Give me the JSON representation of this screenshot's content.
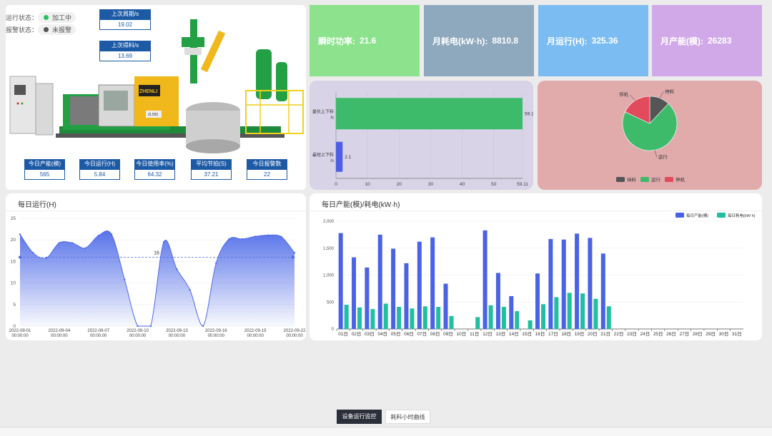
{
  "machine": {
    "run_status_label": "运行状态：",
    "run_status_value": "加工中",
    "run_status_color": "#22c55e",
    "alarm_status_label": "报警状态：",
    "alarm_status_value": "未报警",
    "alarm_status_color": "#555555",
    "last_cycle_label": "上次周期/s",
    "last_cycle_value": "19.02",
    "last_fetch_label": "上次得料/s",
    "last_fetch_value": "13.69",
    "brand_text": "ZHENLI",
    "model_text": "ZL550",
    "stats": [
      {
        "label": "今日产能(模)",
        "value": "565"
      },
      {
        "label": "今日运行(H)",
        "value": "5.84"
      },
      {
        "label": "今日使用率(%)",
        "value": "64.32"
      },
      {
        "label": "平均节拍(S)",
        "value": "37.21"
      },
      {
        "label": "今日报警数",
        "value": "22"
      }
    ]
  },
  "kpis": [
    {
      "label": "瞬时功率:",
      "value": "21.6",
      "color": "#8de28d"
    },
    {
      "label": "月耗电(kW·h):",
      "value": "8810.8",
      "color": "#8ea8bd"
    },
    {
      "label": "月运行(H):",
      "value": "325.36",
      "color": "#7bbcf2"
    },
    {
      "label": "月产能(模):",
      "value": "26283",
      "color": "#d1a9e8"
    }
  ],
  "bar_panel": {
    "bg": "#d8d3e6",
    "chart_data": {
      "type": "bar",
      "orientation": "horizontal",
      "categories": [
        "最长上下料/s",
        "最短上下料/s"
      ],
      "values": [
        59.1,
        2.1
      ],
      "colors": [
        "#3dbb6b",
        "#4f5ee6"
      ],
      "xticks": [
        "0",
        "10",
        "20",
        "30",
        "40",
        "50",
        "59.11"
      ],
      "xlim": [
        0,
        59.11
      ]
    }
  },
  "pie_panel": {
    "bg": "#e1abac",
    "chart_data": {
      "type": "pie",
      "slices": [
        {
          "name": "待料",
          "value": 12,
          "color": "#555555"
        },
        {
          "name": "运行",
          "value": 70,
          "color": "#3dbb6b"
        },
        {
          "name": "停机",
          "value": 18,
          "color": "#e14b5c"
        }
      ],
      "legend": "bottom"
    }
  },
  "daily_run": {
    "title": "每日运行(H)",
    "chart_data": {
      "type": "area",
      "yticks": [
        "0",
        "5",
        "10",
        "15",
        "20",
        "25"
      ],
      "ylim": [
        0,
        25
      ],
      "x_labels": [
        "2022-09-01",
        "2022-09-04",
        "2022-09-07",
        "2022-09-10",
        "2022-09-13",
        "2022-09-16",
        "2022-09-19",
        "2022-09-22"
      ],
      "x_sublabel": "00:00:00",
      "values": [
        21.3,
        17,
        15.8,
        19.3,
        19.3,
        18.1,
        21,
        21.3,
        10.8,
        0,
        0,
        19.5,
        13.2,
        8.4,
        0,
        14.6,
        20.2,
        20.2,
        20.8,
        21.1,
        20.7,
        17
      ],
      "avg_value": 16,
      "avg_label": "16",
      "color": "#4f6be8"
    }
  },
  "daily_prod": {
    "title": "每日产能(模)/耗电(kW·h)",
    "chart_data": {
      "type": "bar",
      "categories": [
        "01日",
        "02日",
        "03日",
        "04日",
        "05日",
        "06日",
        "07日",
        "08日",
        "09日",
        "10日",
        "11日",
        "12日",
        "13日",
        "14日",
        "15日",
        "16日",
        "17日",
        "18日",
        "19日",
        "20日",
        "21日",
        "22日",
        "23日",
        "24日",
        "25日",
        "26日",
        "27日",
        "28日",
        "29日",
        "30日",
        "31日"
      ],
      "yticks": [
        "0",
        "500",
        "1,000",
        "1,500",
        "2,000"
      ],
      "ylim": [
        0,
        2000
      ],
      "series": [
        {
          "name": "每日产能(模)",
          "color": "#4a63e6",
          "values": [
            1780,
            1330,
            1140,
            1750,
            1490,
            1220,
            1620,
            1700,
            840,
            0,
            0,
            1830,
            1040,
            610,
            0,
            1030,
            1670,
            1660,
            1770,
            1690,
            1400,
            0,
            0,
            0,
            0,
            0,
            0,
            0,
            0,
            0,
            0
          ]
        },
        {
          "name": "每日耗电(kW·h)",
          "color": "#1fbfa0",
          "values": [
            450,
            400,
            370,
            470,
            410,
            380,
            420,
            410,
            240,
            0,
            220,
            440,
            410,
            330,
            160,
            460,
            590,
            670,
            660,
            560,
            420,
            0,
            0,
            0,
            0,
            0,
            0,
            0,
            0,
            0,
            0
          ]
        }
      ],
      "legend": "top-right"
    }
  },
  "tabs": [
    {
      "label": "设备运行监控",
      "active": true
    },
    {
      "label": "耗料小时曲线",
      "active": false
    }
  ]
}
